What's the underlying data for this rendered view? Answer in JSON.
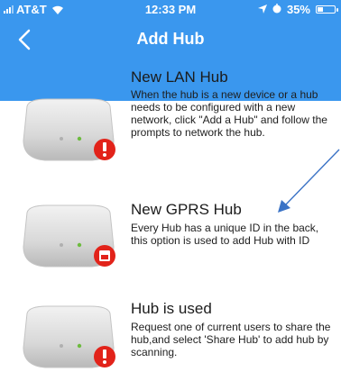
{
  "status_bar": {
    "carrier": "AT&T",
    "time": "12:33 PM",
    "battery": "35%",
    "battery_level": 0.35
  },
  "nav": {
    "title": "Add Hub",
    "back_icon": "chevron-left-icon"
  },
  "items": [
    {
      "title": "New LAN Hub",
      "description": "When the hub is a new device or a hub needs to be configured with a new network, click \"Add a Hub\" and follow the prompts to network the hub.",
      "badge_icon": "exclamation-icon"
    },
    {
      "title": "New GPRS Hub",
      "description": "Every Hub has a unique ID in the back, this option is used to add Hub with ID",
      "badge_icon": "card-icon"
    },
    {
      "title": "Hub is used",
      "description": "Request one of current users to share the hub,and select 'Share Hub' to add hub by scanning.",
      "badge_icon": "exclamation-icon"
    }
  ],
  "colors": {
    "header": "#3a97ee",
    "badge": "#e2231a",
    "arrow": "#3b73c6"
  }
}
